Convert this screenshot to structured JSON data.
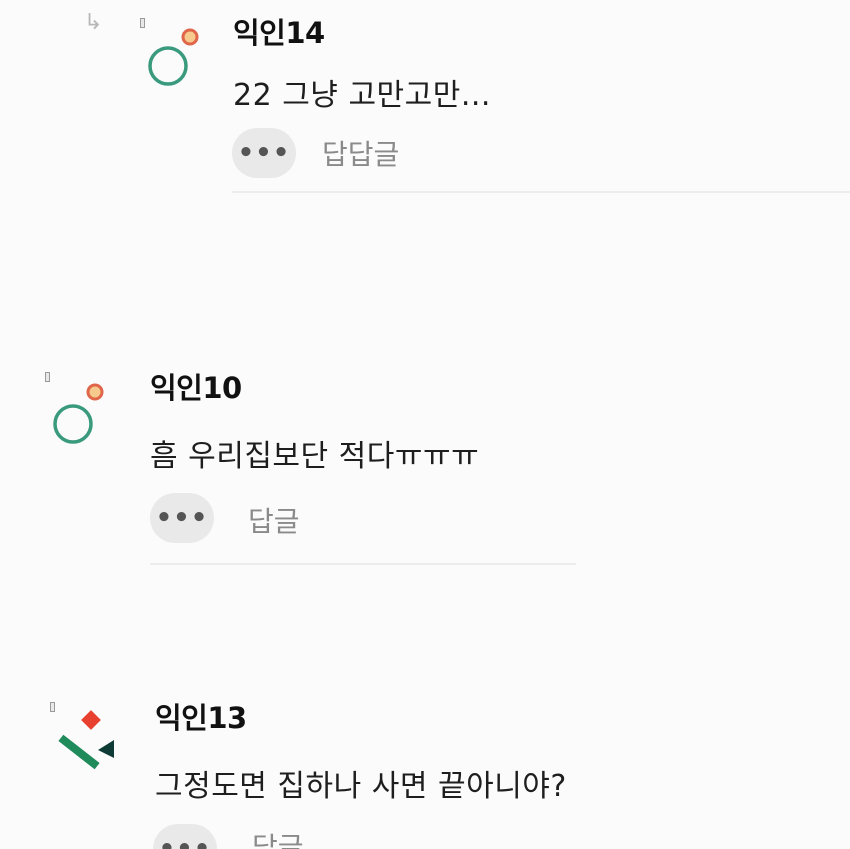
{
  "comments": [
    {
      "author": "익인14",
      "text": "22 그냥 고만고만...",
      "more_label": "•••",
      "reply_label": "답답글",
      "is_reply": true,
      "avatar_icon": "circle-dot-icon"
    },
    {
      "author": "익인10",
      "text": "흠 우리집보단 적다ㅠㅠㅠ",
      "more_label": "•••",
      "reply_label": "답글",
      "is_reply": false,
      "avatar_icon": "circle-dot-icon"
    },
    {
      "author": "익인13",
      "text": "그정도면 집하나 사면 끝아니야?",
      "more_label": "•••",
      "reply_label": "답글",
      "is_reply": false,
      "avatar_icon": "shapes-icon"
    }
  ],
  "reply_arrow_icon": "reply-arrow-icon",
  "colors": {
    "avatar_ring": "#3a9a7e",
    "avatar_dot_fill": "#f6c98c",
    "avatar_dot_stroke": "#e0664a",
    "shape_red": "#e8412f",
    "shape_green": "#1f8a5a",
    "shape_dark": "#0f3b36"
  }
}
